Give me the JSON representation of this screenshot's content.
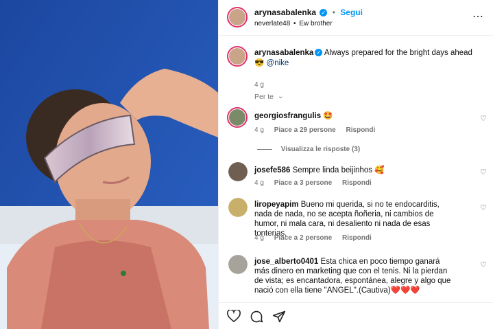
{
  "post": {
    "username": "arynasabalenka",
    "follow_label": "Segui",
    "dot": "•",
    "audio_user": "neverlate48",
    "audio_sep": "•",
    "audio_title": "Ew brother",
    "more_icon": "more-horizontal-icon"
  },
  "caption": {
    "username": "arynasabalenka",
    "text": "Always prepared for the bright days ahead",
    "emoji": "😎",
    "mention": "@nike",
    "time": "4 g"
  },
  "sort": {
    "label": "Per te",
    "chevron": "⌵"
  },
  "comments": [
    {
      "username": "georgiosfrangulis",
      "text": "🤩",
      "time": "4 g",
      "likes": "Piace a 29 persone",
      "reply": "Rispondi",
      "view_replies": "Visualizza le risposte (3)"
    },
    {
      "username": "josefe586",
      "text": "Sempre linda beijinhos 🥰",
      "time": "4 g",
      "likes": "Piace a 3 persone",
      "reply": "Rispondi"
    },
    {
      "username": "liropeyapim",
      "text": "Bueno mi querida, si no te endocarditis, nada de nada, no se acepta ñoñeria, ni cambios de humor, ni mala cara, ni desaliento ni nada de esas tonterias.",
      "time": "4 g",
      "likes": "Piace a 2 persone",
      "reply": "Rispondi"
    },
    {
      "username": "jose_alberto0401",
      "text": "Esta chica en poco tiempo ganará más dinero en marketing que con el tenis. Ni la pierdan de vista; es encantadora, espontánea, alegre y algo que nació con ella tiene \"ANGEL\".(Cautiva)❤️❤️❤️"
    }
  ],
  "actions": {
    "like_icon": "heart-icon",
    "comment_icon": "comment-icon",
    "share_icon": "share-icon"
  },
  "colors": {
    "accent": "#0095f6",
    "story_ring": "#e1306c",
    "photo_bg": "#1f4fa8"
  }
}
